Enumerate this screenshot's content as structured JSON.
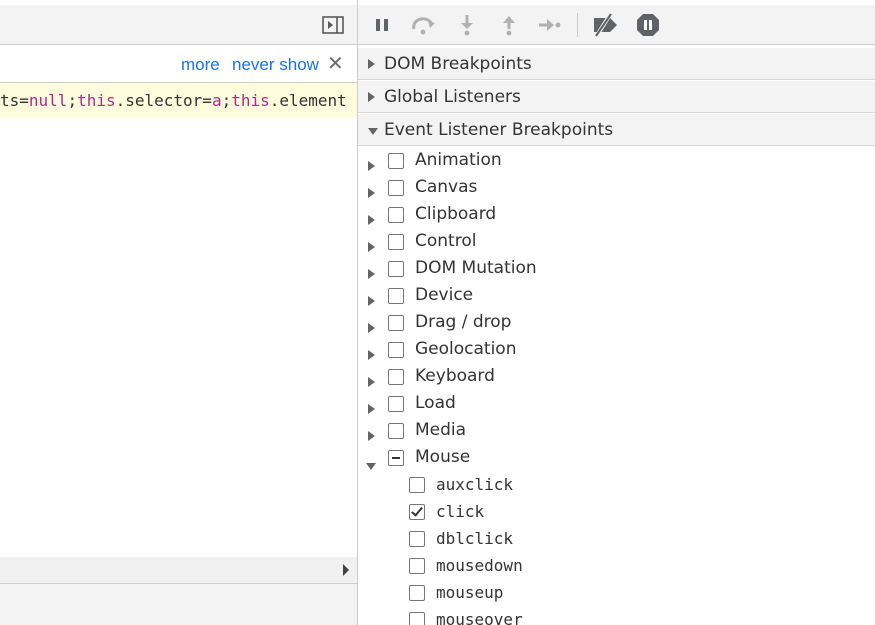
{
  "infobar": {
    "more_label": "more",
    "never_show_label": "never show",
    "close_glyph": "✕"
  },
  "code": {
    "tokens": [
      {
        "text": "ts=",
        "kind": "plain"
      },
      {
        "text": "null",
        "kind": "kw"
      },
      {
        "text": ";",
        "kind": "plain"
      },
      {
        "text": "this",
        "kind": "kw"
      },
      {
        "text": ".selector=",
        "kind": "plain"
      },
      {
        "text": "a",
        "kind": "kw"
      },
      {
        "text": ";",
        "kind": "plain"
      },
      {
        "text": "this",
        "kind": "kw"
      },
      {
        "text": ".element",
        "kind": "plain"
      }
    ]
  },
  "toolbar": {
    "icons": [
      "pause-icon",
      "step-over-icon",
      "step-into-icon",
      "step-out-icon",
      "step-icon",
      "deactivate-breakpoints-icon",
      "pause-on-exceptions-icon"
    ]
  },
  "sections": {
    "dom_breakpoints": "DOM Breakpoints",
    "global_listeners": "Global Listeners",
    "event_listener_breakpoints": "Event Listener Breakpoints"
  },
  "categories": [
    {
      "label": "Animation",
      "state": "unchecked",
      "expanded": false
    },
    {
      "label": "Canvas",
      "state": "unchecked",
      "expanded": false
    },
    {
      "label": "Clipboard",
      "state": "unchecked",
      "expanded": false
    },
    {
      "label": "Control",
      "state": "unchecked",
      "expanded": false
    },
    {
      "label": "DOM Mutation",
      "state": "unchecked",
      "expanded": false
    },
    {
      "label": "Device",
      "state": "unchecked",
      "expanded": false
    },
    {
      "label": "Drag / drop",
      "state": "unchecked",
      "expanded": false
    },
    {
      "label": "Geolocation",
      "state": "unchecked",
      "expanded": false
    },
    {
      "label": "Keyboard",
      "state": "unchecked",
      "expanded": false
    },
    {
      "label": "Load",
      "state": "unchecked",
      "expanded": false
    },
    {
      "label": "Media",
      "state": "unchecked",
      "expanded": false
    },
    {
      "label": "Mouse",
      "state": "mixed",
      "expanded": true
    }
  ],
  "mouse_events": [
    {
      "label": "auxclick",
      "checked": false
    },
    {
      "label": "click",
      "checked": true
    },
    {
      "label": "dblclick",
      "checked": false
    },
    {
      "label": "mousedown",
      "checked": false
    },
    {
      "label": "mouseup",
      "checked": false
    },
    {
      "label": "mouseover",
      "checked": false
    }
  ],
  "colors": {
    "link": "#1a73e8",
    "keyword": "#a92e8a",
    "code_highlight": "#fffbdd",
    "toolbar_bg": "#f3f3f3"
  }
}
